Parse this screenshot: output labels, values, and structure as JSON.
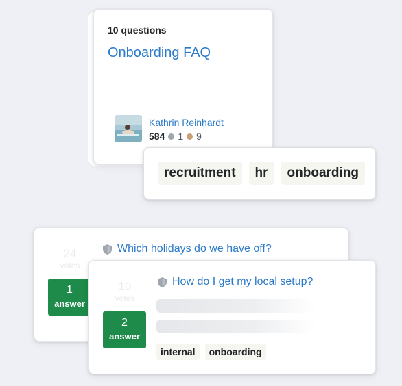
{
  "collection": {
    "count_label": "10 questions",
    "title": "Onboarding FAQ",
    "author": {
      "name": "Kathrin Reinhardt",
      "reputation": "584",
      "silver_badges": "1",
      "bronze_badges": "9"
    }
  },
  "tag_popup": {
    "tags": [
      "recruitment",
      "hr",
      "onboarding"
    ]
  },
  "questions": [
    {
      "votes": "24",
      "votes_label": "votes",
      "answers": "1",
      "answers_label": "answer",
      "title": "Which holidays do we have off?"
    },
    {
      "votes": "10",
      "votes_label": "votes",
      "answers": "2",
      "answers_label": "answer",
      "title": "How do I get my local setup?",
      "tags": [
        "internal",
        "onboarding"
      ]
    }
  ],
  "colors": {
    "link": "#2b7ac9",
    "answered": "#1e8b4a",
    "silver_badge": "#9fa6ad",
    "bronze_badge": "#c79e75",
    "background": "#eef0f5"
  }
}
